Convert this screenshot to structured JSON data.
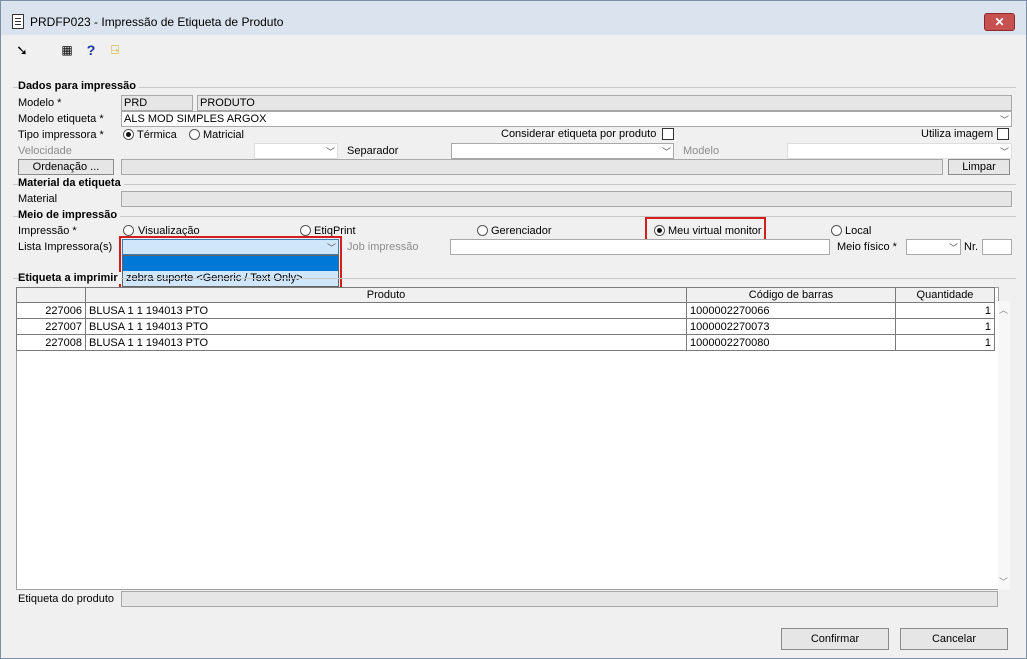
{
  "window": {
    "title": "PRDFP023 - Impressão de Etiqueta de Produto",
    "close_label": "✕"
  },
  "toolbar": {
    "help_label": "?"
  },
  "dados": {
    "legend": "Dados para impressão",
    "modelo_label": "Modelo *",
    "modelo_code": "PRD",
    "modelo_desc": "PRODUTO",
    "modelo_etiqueta_label": "Modelo etiqueta *",
    "modelo_etiqueta_value": "ALS MOD SIMPLES ARGOX",
    "tipo_label": "Tipo impressora *",
    "tipo_termica": "Térmica",
    "tipo_matricial": "Matricial",
    "considerar_label": "Considerar etiqueta por produto",
    "utiliza_imagem_label": "Utiliza imagem",
    "velocidade_label": "Velocidade",
    "separador_label": "Separador",
    "modelo2_label": "Modelo",
    "ordenacao_label": "Ordenação ...",
    "limpar_label": "Limpar"
  },
  "material": {
    "legend": "Material da etiqueta",
    "material_label": "Material"
  },
  "meio": {
    "legend": "Meio de impressão",
    "impressao_label": "Impressão *",
    "opt_visualizacao": "Visualização",
    "opt_etiqprint": "EtiqPrint",
    "opt_gerenciador": "Gerenciador",
    "opt_meu_virtual": "Meu virtual monitor",
    "opt_local": "Local",
    "lista_label": "Lista Impressora(s)",
    "lista_value": "",
    "dropdown_option": "zebra suporte <Generic / Text Only>",
    "job_label": "Job impressão",
    "meio_fisico_label": "Meio físico *",
    "nr_label": "Nr."
  },
  "etiqueta": {
    "legend": "Etiqueta a imprimir",
    "columns": [
      "Produto",
      "Código de barras",
      "Quantidade"
    ],
    "rows": [
      {
        "id": "227006",
        "produto": "BLUSA 1 1 194013 PTO",
        "codigo": "1000002270066",
        "qtd": "1"
      },
      {
        "id": "227007",
        "produto": "BLUSA 1 1 194013 PTO",
        "codigo": "1000002270073",
        "qtd": "1"
      },
      {
        "id": "227008",
        "produto": "BLUSA 1 1 194013 PTO",
        "codigo": "1000002270080",
        "qtd": "1"
      }
    ],
    "etiqueta_produto_label": "Etiqueta do produto"
  },
  "footer": {
    "confirmar_label": "Confirmar",
    "cancelar_label": "Cancelar"
  }
}
